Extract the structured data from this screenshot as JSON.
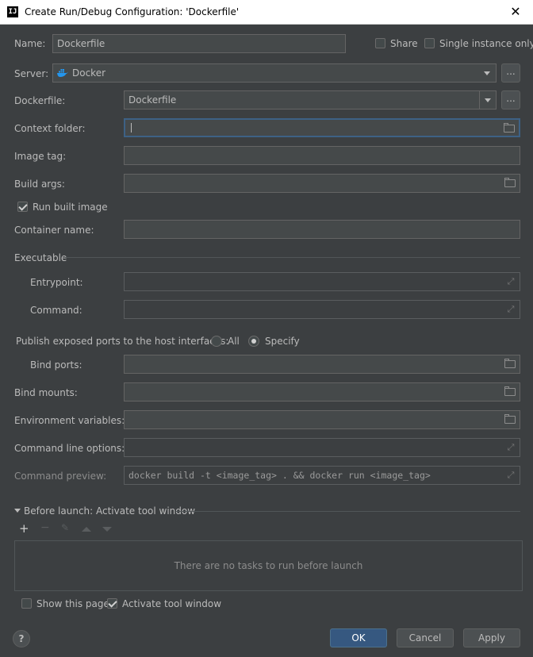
{
  "window": {
    "title": "Create Run/Debug Configuration: 'Dockerfile'",
    "close_glyph": "✕",
    "app_icon_text": "IJ"
  },
  "name_row": {
    "label": "Name:",
    "value": "Dockerfile",
    "share_label": "Share",
    "share_checked": false,
    "single_instance_label": "Single instance only",
    "single_instance_checked": false
  },
  "server": {
    "label": "Server:",
    "value": "Docker",
    "icon": "docker-whale-icon",
    "more_label": "..."
  },
  "dockerfile": {
    "label": "Dockerfile:",
    "value": "Dockerfile",
    "more_label": "..."
  },
  "context_folder": {
    "label": "Context folder:",
    "value": ""
  },
  "image_tag": {
    "label": "Image tag:",
    "value": ""
  },
  "build_args": {
    "label": "Build args:",
    "value": ""
  },
  "run_built_image": {
    "label": "Run built image",
    "checked": true
  },
  "container_name": {
    "label": "Container name:",
    "value": ""
  },
  "executable": {
    "section_label": "Executable",
    "entrypoint_label": "Entrypoint:",
    "entrypoint_value": "",
    "command_label": "Command:",
    "command_value": ""
  },
  "publish_ports": {
    "label": "Publish exposed ports to the host interfaces:",
    "options": [
      "All",
      "Specify"
    ],
    "selected": "Specify"
  },
  "bind_ports": {
    "label": "Bind ports:",
    "value": ""
  },
  "bind_mounts": {
    "label": "Bind mounts:",
    "value": ""
  },
  "env_vars": {
    "label": "Environment variables:",
    "value": ""
  },
  "cmd_options": {
    "label": "Command line options:",
    "value": ""
  },
  "cmd_preview": {
    "label": "Command preview:",
    "value": "docker build -t <image_tag> . && docker run <image_tag>"
  },
  "before_launch": {
    "header": "Before launch: Activate tool window",
    "toolbar": [
      "add-icon",
      "remove-icon",
      "edit-icon",
      "move-up-icon",
      "move-down-icon"
    ],
    "empty_text": "There are no tasks to run before launch",
    "show_page_label": "Show this page",
    "show_page_checked": false,
    "activate_tool_label": "Activate tool window",
    "activate_tool_checked": true
  },
  "footer": {
    "help_label": "?",
    "ok_label": "OK",
    "cancel_label": "Cancel",
    "apply_label": "Apply"
  },
  "colors": {
    "background": "#3c3f41",
    "field_background": "#45494a",
    "primary_button": "#365880",
    "focus_border": "#3d6185",
    "docker_blue": "#2496ed"
  }
}
